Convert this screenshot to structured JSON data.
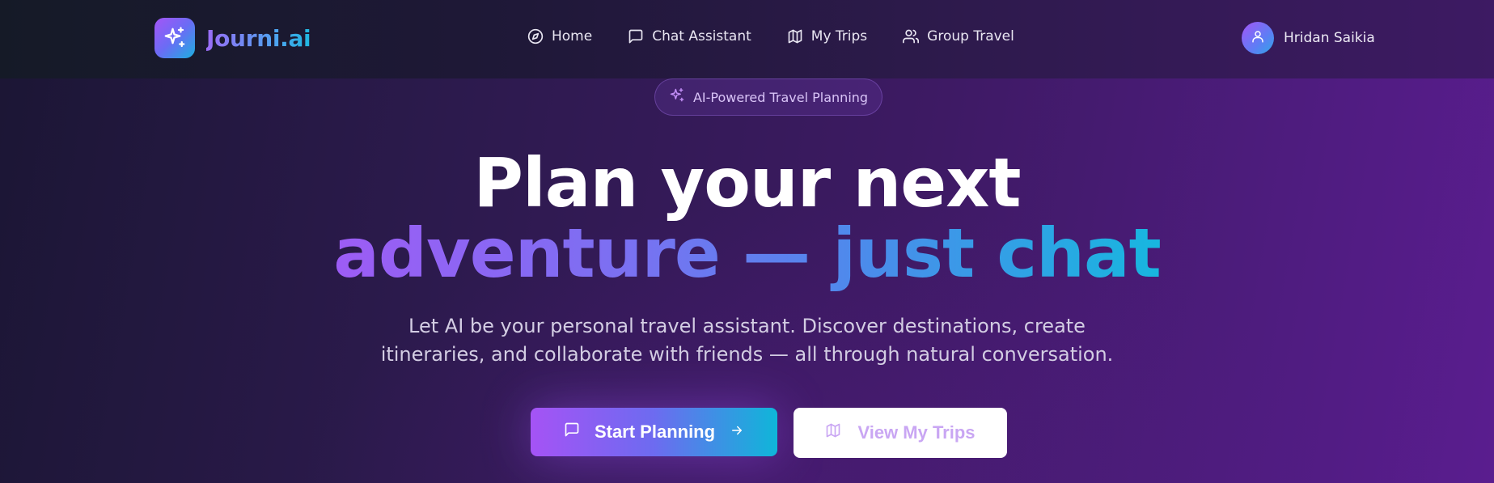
{
  "app": {
    "name": "Journi.ai"
  },
  "nav": {
    "items": [
      {
        "label": "Home",
        "icon": "compass-icon"
      },
      {
        "label": "Chat Assistant",
        "icon": "chat-icon"
      },
      {
        "label": "My Trips",
        "icon": "map-icon"
      },
      {
        "label": "Group Travel",
        "icon": "users-icon"
      }
    ]
  },
  "user": {
    "name": "Hridan Saikia",
    "icon": "user-icon"
  },
  "hero": {
    "badge": "AI-Powered Travel Planning",
    "title_line1": "Plan your next",
    "title_line2": "adventure — just chat",
    "subtitle_line1": "Let AI be your personal travel assistant. Discover destinations, create",
    "subtitle_line2": "itineraries, and collaborate with friends — all through natural conversation.",
    "primary_button": "Start Planning",
    "secondary_button": "View My Trips"
  },
  "colors": {
    "accent_purple": "#a553f5",
    "accent_cyan": "#0fb6d9",
    "background_dark": "#1b1634",
    "background_purple": "#5a1d8f"
  }
}
